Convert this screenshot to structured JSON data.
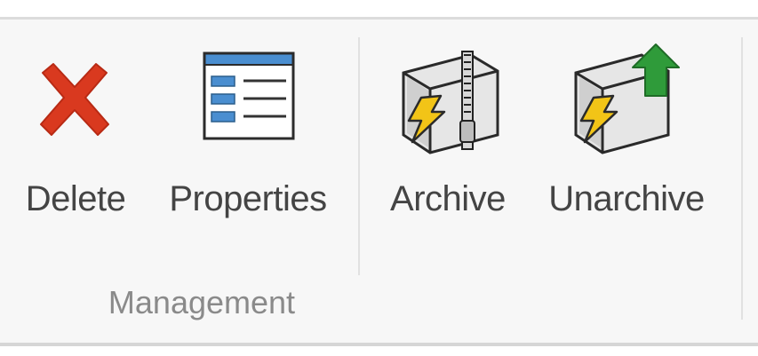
{
  "ribbon": {
    "group_label": "Management",
    "buttons": [
      {
        "label": "Delete",
        "icon": "delete-x-icon",
        "color": "#d9391f"
      },
      {
        "label": "Properties",
        "icon": "properties-list-icon",
        "color": "#3a79b5"
      },
      {
        "label": "Archive",
        "icon": "archive-zip-icon",
        "color": "#f2c417"
      },
      {
        "label": "Unarchive",
        "icon": "unarchive-up-arrow-icon",
        "color": "#2f9b3a"
      }
    ]
  }
}
